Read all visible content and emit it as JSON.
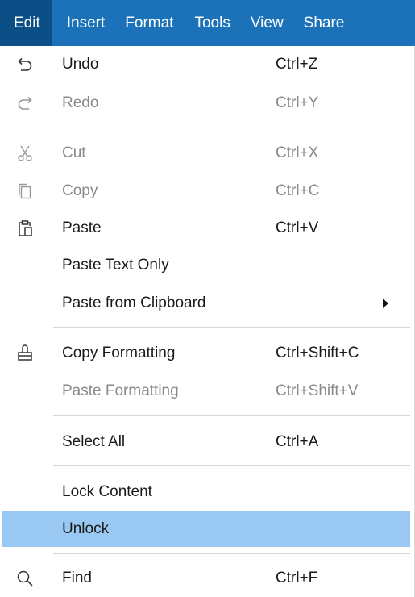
{
  "menubar": {
    "items": [
      "Edit",
      "Insert",
      "Format",
      "Tools",
      "View",
      "Share"
    ]
  },
  "menu": {
    "undo": {
      "label": "Undo",
      "shortcut": "Ctrl+Z"
    },
    "redo": {
      "label": "Redo",
      "shortcut": "Ctrl+Y"
    },
    "cut": {
      "label": "Cut",
      "shortcut": "Ctrl+X"
    },
    "copy": {
      "label": "Copy",
      "shortcut": "Ctrl+C"
    },
    "paste": {
      "label": "Paste",
      "shortcut": "Ctrl+V"
    },
    "paste_text_only": {
      "label": "Paste Text Only"
    },
    "paste_from_clipboard": {
      "label": "Paste from Clipboard"
    },
    "copy_formatting": {
      "label": "Copy Formatting",
      "shortcut": "Ctrl+Shift+C"
    },
    "paste_formatting": {
      "label": "Paste Formatting",
      "shortcut": "Ctrl+Shift+V"
    },
    "select_all": {
      "label": "Select All",
      "shortcut": "Ctrl+A"
    },
    "lock_content": {
      "label": "Lock Content"
    },
    "unlock": {
      "label": "Unlock"
    },
    "find": {
      "label": "Find",
      "shortcut": "Ctrl+F"
    }
  },
  "icons": {
    "undo": "undo-icon",
    "redo": "redo-icon",
    "cut": "scissors-icon",
    "copy": "copy-icon",
    "paste": "clipboard-icon",
    "copy_formatting": "format-painter-icon",
    "find": "search-icon",
    "submenu": "chevron-right-icon"
  },
  "colors": {
    "menubar_bg": "#1b72b8",
    "menubar_active_bg": "#0b4f86",
    "highlight_bg": "#99c9f3",
    "disabled_text": "#8a8a8a"
  }
}
